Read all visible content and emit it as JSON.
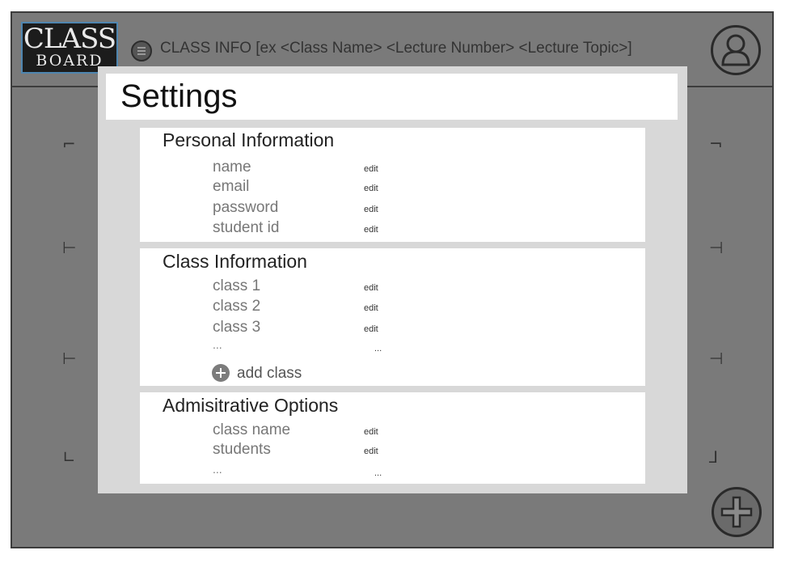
{
  "header": {
    "logo_line1": "CLASS",
    "logo_line2": "BOARD",
    "class_info": "CLASS INFO [ex <Class Name> <Lecture Number> <Lecture Topic>]"
  },
  "icons": {
    "menu": "hamburger-menu-icon",
    "avatar": "user-avatar-icon",
    "fab": "plus-icon",
    "add_class": "plus-circle-icon"
  },
  "corners": {
    "tl": "⌐",
    "tr": "¬",
    "ml1": "⊢",
    "mr1": "⊣",
    "ml2": "⊢",
    "mr2": "⊣",
    "bl": "∟",
    "br": "⅃"
  },
  "settings": {
    "title": "Settings",
    "personal": {
      "title": "Personal Information",
      "rows": [
        {
          "label": "name",
          "action": "edit"
        },
        {
          "label": "email",
          "action": "edit"
        },
        {
          "label": "password",
          "action": "edit"
        },
        {
          "label": "student id",
          "action": "edit"
        }
      ]
    },
    "classes": {
      "title": "Class Information",
      "rows": [
        {
          "label": "class 1",
          "action": "edit"
        },
        {
          "label": "class 2",
          "action": "edit"
        },
        {
          "label": "class 3",
          "action": "edit"
        },
        {
          "label": "...",
          "action": "..."
        }
      ],
      "add_label": "add class"
    },
    "admin": {
      "title": "Admisitrative Options",
      "rows": [
        {
          "label": "class name",
          "action": "edit"
        },
        {
          "label": "students",
          "action": "edit"
        },
        {
          "label": "...",
          "action": "..."
        }
      ]
    }
  }
}
